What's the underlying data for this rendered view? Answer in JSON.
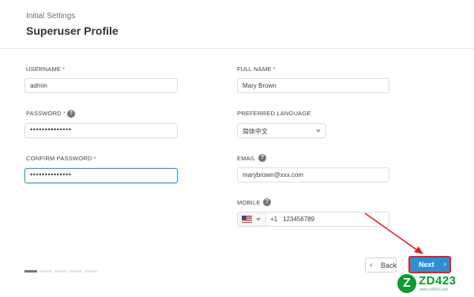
{
  "header": {
    "subtitle": "Initial Settings",
    "title": "Superuser Profile"
  },
  "form": {
    "username": {
      "label": "USERNAME",
      "required_mark": "*",
      "value": "admin"
    },
    "password": {
      "label": "PASSWORD",
      "required_mark": "*",
      "help_icon": "question-circle-icon",
      "help_glyph": "?",
      "value": "••••••••••••••"
    },
    "confirm_password": {
      "label": "CONFIRM PASSWORD",
      "required_mark": "*",
      "value": "••••••••••••••"
    },
    "full_name": {
      "label": "FULL NAME",
      "required_mark": "*",
      "value": "Mary Brown"
    },
    "preferred_language": {
      "label": "PREFERRED LANGUAGE",
      "value": "简体中文"
    },
    "email": {
      "label": "EMAIL",
      "help_icon": "question-circle-icon",
      "help_glyph": "?",
      "value": "marybrown@xxx.com"
    },
    "mobile": {
      "label": "MOBILE",
      "help_icon": "question-circle-icon",
      "help_glyph": "?",
      "country_flag": "us-flag-icon",
      "dial_code": "+1",
      "value": "123456789"
    }
  },
  "progress": {
    "total_steps": 5,
    "current_step": 1
  },
  "buttons": {
    "back_label": "Back",
    "back_icon": "chevron-left-icon",
    "back_glyph": "‹",
    "next_label": "Next",
    "next_icon": "chevron-right-icon",
    "next_glyph": "›"
  },
  "annotation": {
    "color": "#e02020",
    "icon": "red-arrow-icon"
  },
  "watermark": {
    "letter": "Z",
    "text": "ZD423",
    "url": "www.zd423.com",
    "color": "#0a9a2f"
  },
  "colors": {
    "accent": "#2f8fd3",
    "required": "#e23b3b",
    "focus": "#3a9bd5"
  }
}
